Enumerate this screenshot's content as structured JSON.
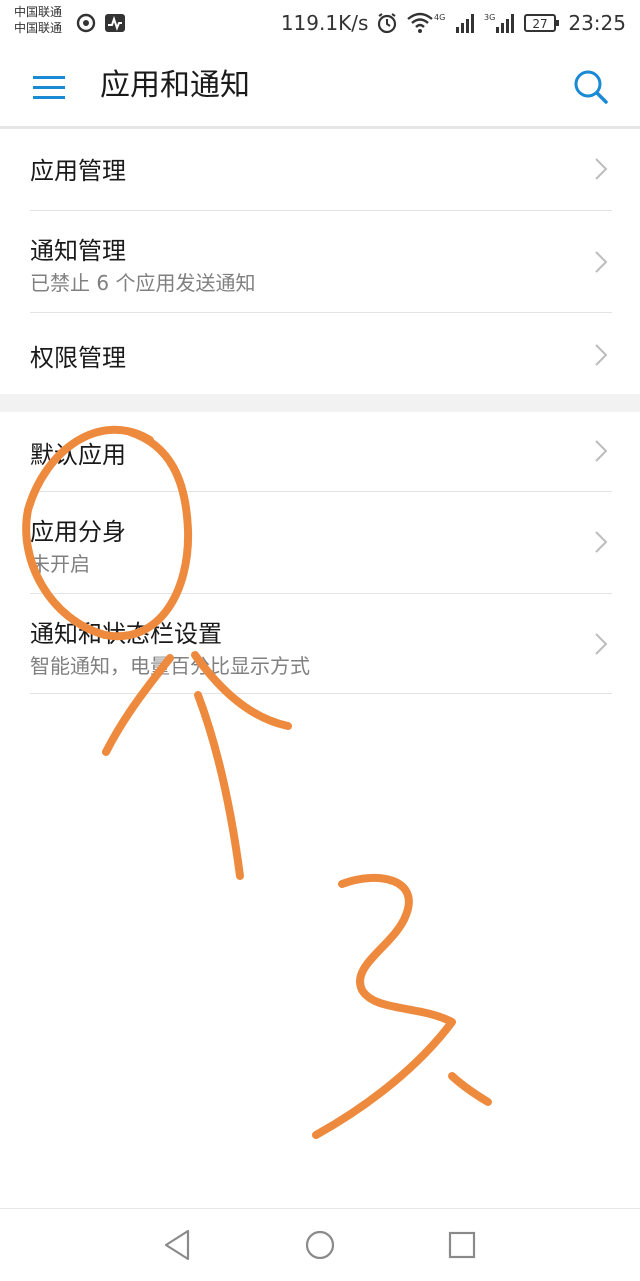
{
  "status": {
    "carrier_1": "中国联通",
    "carrier_2": "中国联通",
    "speed": "119.1K/s",
    "net_4g": "4G",
    "net_3g": "3G",
    "battery": "27",
    "time": "23:25"
  },
  "header": {
    "title": "应用和通知"
  },
  "section1": [
    {
      "label": "应用管理"
    },
    {
      "label": "通知管理",
      "sub": "已禁止 6 个应用发送通知"
    },
    {
      "label": "权限管理"
    }
  ],
  "section2": [
    {
      "label": "默认应用"
    },
    {
      "label": "应用分身",
      "sub": "未开启"
    },
    {
      "label": "通知和状态栏设置",
      "sub": "智能通知，电量百分比显示方式"
    }
  ],
  "colors": {
    "accent": "#1a8ad4",
    "annotation": "#ee8a3e"
  }
}
